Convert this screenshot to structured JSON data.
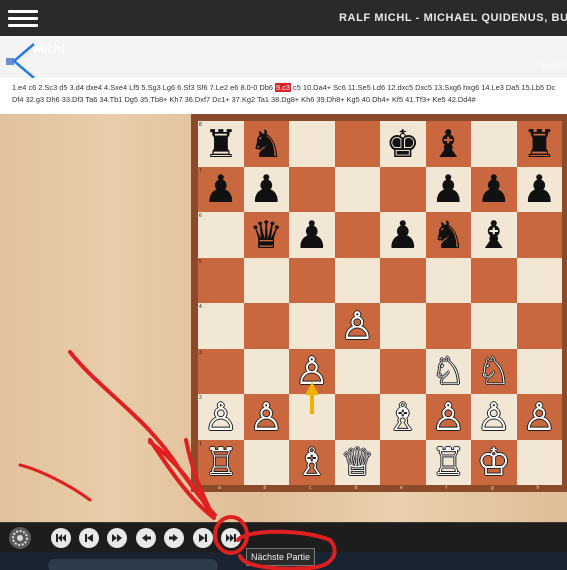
{
  "topbar": {
    "title": "RALF MICHL - MICHAEL QUIDENUS, BU",
    "menu_icon": "hamburger-menu-icon"
  },
  "header": {
    "name": "Michl",
    "right_text": "Burgh",
    "back_icon": "back-arrow-icon"
  },
  "notation": {
    "line1_before": "1.e4 c6 2.Sc3 d5 3.d4 dxe4 4.Sxe4 Lf5 5.Sg3 Lg6 6.Sf3 Sf6 7.Le2 e6 8.0-0 Db6 ",
    "current_move": "9.c3",
    "line1_after": " c5 10.Da4+ Sc6 11.Se5 Ld6 12.dxc5 Dxc5 13.Sxg6 hxg6 14.Le3 Da5 15.Lb5 Dc",
    "line2": "Df4 32.g3 Dh6 33.Df3 Ta6 34.Tb1 Dg5 35.Tb8+ Kh7 36.Dxf7 Dc1+ 37.Kg2 Ta1 38.Dg8+ Kh6 39.Dh8+ Kg5 40.Dh4+ Kf5 41.Tf3+ Ke5 42.Dd4#"
  },
  "board": {
    "ranks": [
      "8",
      "7",
      "6",
      "5",
      "4",
      "3",
      "2",
      "1"
    ],
    "files": [
      "a",
      "b",
      "c",
      "d",
      "e",
      "f",
      "g",
      "h"
    ],
    "light_color": "#f2e6d5",
    "dark_color": "#c9683f",
    "pieces": [
      {
        "sq": "a8",
        "p": "♜",
        "c": "b"
      },
      {
        "sq": "b8",
        "p": "♞",
        "c": "b"
      },
      {
        "sq": "e8",
        "p": "♚",
        "c": "b"
      },
      {
        "sq": "f8",
        "p": "♝",
        "c": "b"
      },
      {
        "sq": "h8",
        "p": "♜",
        "c": "b"
      },
      {
        "sq": "a7",
        "p": "♟",
        "c": "b"
      },
      {
        "sq": "b7",
        "p": "♟",
        "c": "b"
      },
      {
        "sq": "f7",
        "p": "♟",
        "c": "b"
      },
      {
        "sq": "g7",
        "p": "♟",
        "c": "b"
      },
      {
        "sq": "h7",
        "p": "♟",
        "c": "b"
      },
      {
        "sq": "b6",
        "p": "♛",
        "c": "b"
      },
      {
        "sq": "c6",
        "p": "♟",
        "c": "b"
      },
      {
        "sq": "e6",
        "p": "♟",
        "c": "b"
      },
      {
        "sq": "f6",
        "p": "♞",
        "c": "b"
      },
      {
        "sq": "g6",
        "p": "♝",
        "c": "b"
      },
      {
        "sq": "d4",
        "p": "♙",
        "c": "w"
      },
      {
        "sq": "c3",
        "p": "♙",
        "c": "w"
      },
      {
        "sq": "f3",
        "p": "♘",
        "c": "w"
      },
      {
        "sq": "g3",
        "p": "♘",
        "c": "w"
      },
      {
        "sq": "a2",
        "p": "♙",
        "c": "w"
      },
      {
        "sq": "b2",
        "p": "♙",
        "c": "w"
      },
      {
        "sq": "e2",
        "p": "♗",
        "c": "w"
      },
      {
        "sq": "f2",
        "p": "♙",
        "c": "w"
      },
      {
        "sq": "g2",
        "p": "♙",
        "c": "w"
      },
      {
        "sq": "h2",
        "p": "♙",
        "c": "w"
      },
      {
        "sq": "a1",
        "p": "♖",
        "c": "w"
      },
      {
        "sq": "c1",
        "p": "♗",
        "c": "w"
      },
      {
        "sq": "d1",
        "p": "♕",
        "c": "w"
      },
      {
        "sq": "f1",
        "p": "♖",
        "c": "w"
      },
      {
        "sq": "g1",
        "p": "♔",
        "c": "w"
      }
    ],
    "last_move": {
      "from": "c2",
      "to": "c3",
      "arrow_color": "#f0b000"
    }
  },
  "toolbar": {
    "buttons": [
      {
        "name": "first-game-button",
        "icon": "skip-to-start-icon"
      },
      {
        "name": "previous-game-button",
        "icon": "skip-back-icon"
      },
      {
        "name": "fast-forward-button",
        "icon": "fast-forward-icon"
      },
      {
        "name": "previous-move-button",
        "icon": "arrow-left-icon"
      },
      {
        "name": "next-move-button",
        "icon": "arrow-right-icon"
      },
      {
        "name": "last-move-button",
        "icon": "skip-to-end-icon"
      },
      {
        "name": "next-game-button",
        "icon": "next-game-icon"
      }
    ],
    "tooltip": "Nächste Partie"
  },
  "annotation_color": "#e02020"
}
